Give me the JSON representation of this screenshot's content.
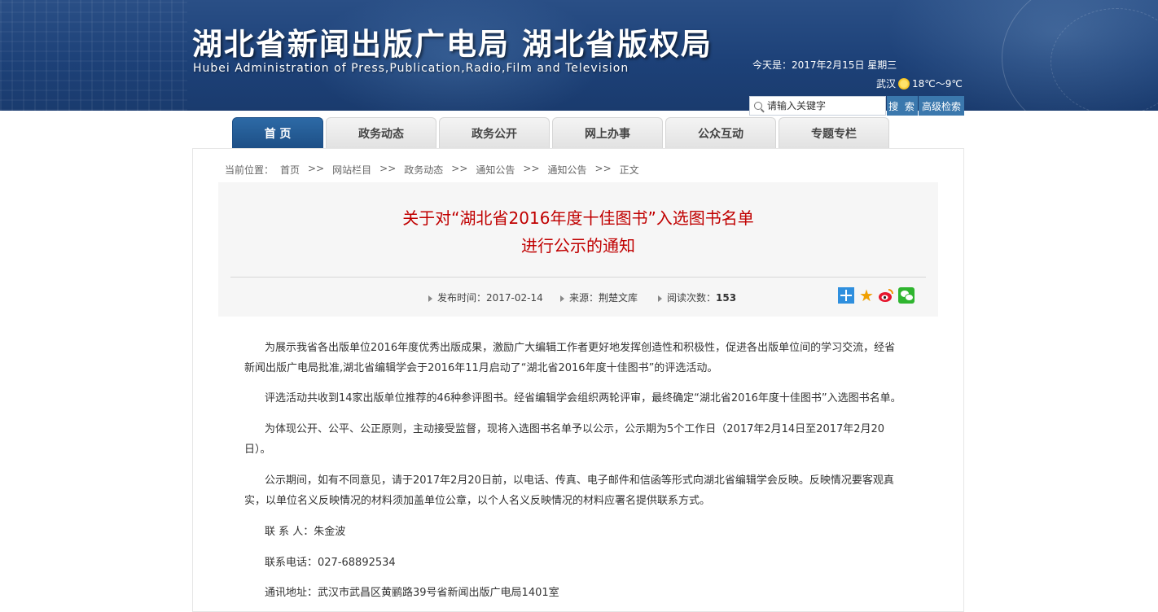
{
  "header": {
    "title": "湖北省新闻出版广电局 湖北省版权局",
    "subtitle": "Hubei Administration of Press,Publication,Radio,Film and Television",
    "date": "今天是：2017年2月15日 星期三",
    "weather_city": "武汉",
    "weather_icon": "sun-cloud-icon",
    "weather_temp": "18℃～9℃",
    "search_placeholder": "请输入关键字",
    "search_button": "搜 索",
    "advanced_search_button": "高级检索"
  },
  "nav": {
    "tabs": [
      {
        "label": "首 页",
        "active": true
      },
      {
        "label": "政务动态"
      },
      {
        "label": "政务公开"
      },
      {
        "label": "网上办事"
      },
      {
        "label": "公众互动"
      },
      {
        "label": "专题专栏"
      }
    ]
  },
  "breadcrumb": {
    "prefix": "当前位置：",
    "items": [
      "首页",
      "网站栏目",
      "政务动态",
      "通知公告",
      "通知公告",
      "正文"
    ],
    "separator": ">>"
  },
  "article": {
    "title_line1": "关于对“湖北省2016年度十佳图书”入选图书名单",
    "title_line2": "进行公示的通知",
    "publish_label": "发布时间：2017-02-14",
    "source_label": "来源：荆楚文库",
    "views_label": "阅读次数：",
    "views_count": "153",
    "share_icons": [
      "plus-share-icon",
      "star-icon",
      "weibo-icon",
      "wechat-icon"
    ],
    "paragraphs": [
      "为展示我省各出版单位2016年度优秀出版成果，激励广大编辑工作者更好地发挥创造性和积极性，促进各出版单位间的学习交流，经省新闻出版广电局批准,湖北省编辑学会于2016年11月启动了“湖北省2016年度十佳图书”的评选活动。",
      "评选活动共收到14家出版单位推荐的46种参评图书。经省编辑学会组织两轮评审，最终确定“湖北省2016年度十佳图书”入选图书名单。",
      "为体现公开、公平、公正原则，主动接受监督，现将入选图书名单予以公示，公示期为5个工作日（2017年2月14日至2017年2月20日）。",
      "公示期间，如有不同意见，请于2017年2月20日前，以电话、传真、电子邮件和信函等形式向湖北省编辑学会反映。反映情况要客观真实，以单位名义反映情况的材料须加盖单位公章，以个人名义反映情况的材料应署名提供联系方式。",
      "联 系 人：朱金波",
      "联系电话：027-68892534",
      "通讯地址：武汉市武昌区黄鹂路39号省新闻出版广电局1401室"
    ]
  },
  "colors": {
    "banner": "#1d4178",
    "nav_active": "#2d6aa6",
    "title_red": "#c00000",
    "button_blue": "#3b78ad"
  }
}
